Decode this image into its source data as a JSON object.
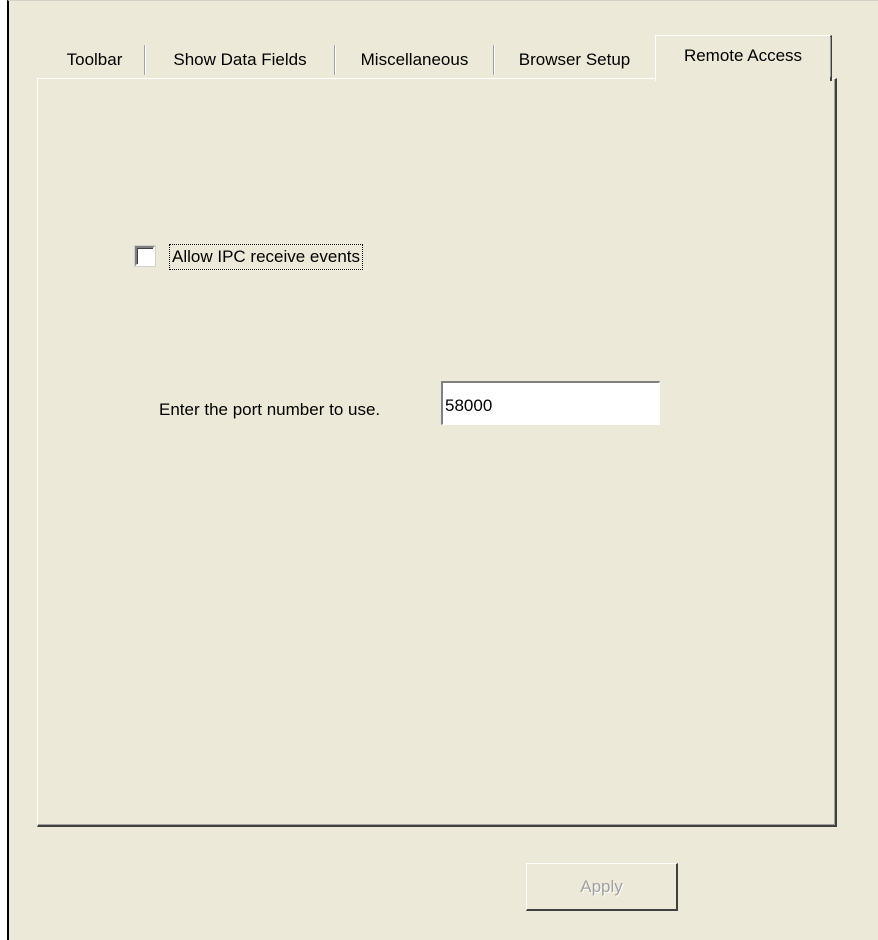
{
  "tabs": [
    {
      "label": "Toolbar"
    },
    {
      "label": "Show Data Fields"
    },
    {
      "label": "Miscellaneous"
    },
    {
      "label": "Browser Setup"
    },
    {
      "label": "Remote Access",
      "selected": true
    }
  ],
  "remote_access": {
    "allow_ipc_label": "Allow IPC receive events",
    "allow_ipc_checked": false,
    "port_label": "Enter the port number to use.",
    "port_value": "58000"
  },
  "footer": {
    "apply_label": "Apply",
    "apply_enabled": false
  }
}
